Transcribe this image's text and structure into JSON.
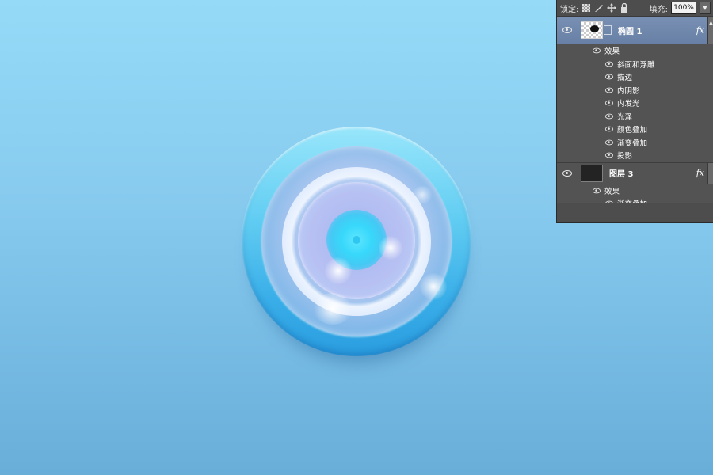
{
  "toolbar": {
    "lock_label": "锁定:",
    "fill_label": "填充:",
    "fill_value": "100%"
  },
  "layers": [
    {
      "name": "椭圆 1",
      "selected": true,
      "fx": "fx",
      "effects_label": "效果",
      "effects": [
        "斜面和浮雕",
        "描边",
        "内阴影",
        "内发光",
        "光泽",
        "颜色叠加",
        "渐变叠加",
        "投影"
      ]
    },
    {
      "name": "图层 3",
      "selected": false,
      "fx": "fx",
      "effects_label": "效果",
      "effects": [
        "渐变叠加"
      ]
    }
  ],
  "colors": {
    "background_top": "#95dbf7",
    "background_bottom": "#68aed9",
    "disc_outer": "#39aee8",
    "core": "#38d8fb",
    "selected_layer": "#7890b3"
  },
  "icons": [
    "eye-icon",
    "lock-transparent-icon",
    "brush-icon",
    "move-icon",
    "lock-icon",
    "fx-icon",
    "chevron-down-icon"
  ]
}
